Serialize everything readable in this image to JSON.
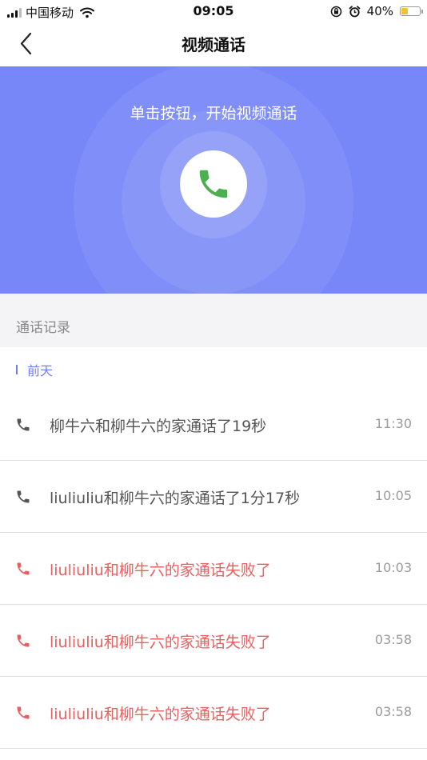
{
  "status_bar": {
    "carrier": "中国移动",
    "time": "09:05",
    "battery_percent": "40%",
    "battery_level": 0.4,
    "battery_color": "#f2c230"
  },
  "nav": {
    "title": "视频通话",
    "back_icon": "chevron-left-icon"
  },
  "hero": {
    "prompt": "单击按钮，开始视频通话",
    "background": "#7787f8",
    "call_icon": "phone-icon",
    "call_icon_color": "#4caf50"
  },
  "history": {
    "title": "通话记录",
    "day": "前天",
    "ok_color": "#555555",
    "fail_color": "#ea5f5f",
    "records": [
      {
        "text": "柳牛六和柳牛六的家通话了19秒",
        "time": "11:30",
        "status": "ok"
      },
      {
        "text": "liuliuliu和柳牛六的家通话了1分17秒",
        "time": "10:05",
        "status": "ok"
      },
      {
        "text": "liuliuliu和柳牛六的家通话失败了",
        "time": "10:03",
        "status": "fail"
      },
      {
        "text": "liuliuliu和柳牛六的家通话失败了",
        "time": "03:58",
        "status": "fail"
      },
      {
        "text": "liuliuliu和柳牛六的家通话失败了",
        "time": "03:58",
        "status": "fail"
      }
    ]
  }
}
